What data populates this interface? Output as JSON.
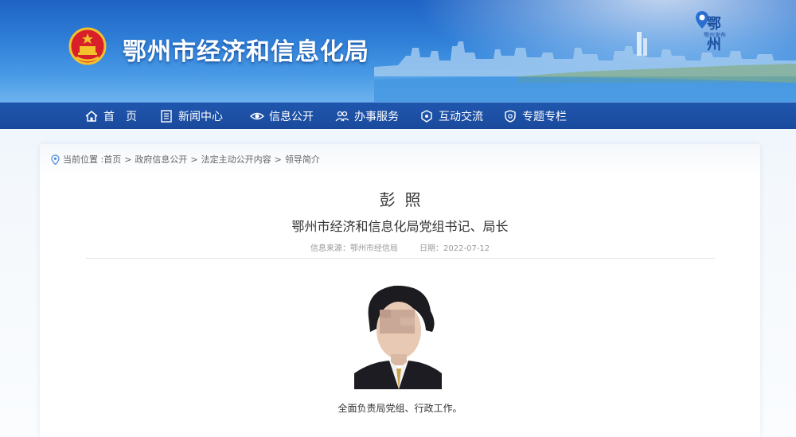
{
  "header": {
    "site_title": "鄂州市经济和信息化局",
    "emblem_icon": "national-emblem-icon",
    "corner_logo_text": "鄂州",
    "corner_logo_sub": "鄂州发布",
    "colors": {
      "banner_top": "#1f63c4",
      "nav_bg": "#1a4a9c"
    }
  },
  "nav": {
    "items": [
      {
        "label": "首　页",
        "icon": "home-icon"
      },
      {
        "label": "新闻中心",
        "icon": "news-icon"
      },
      {
        "label": "信息公开",
        "icon": "eye-icon"
      },
      {
        "label": "办事服务",
        "icon": "service-icon"
      },
      {
        "label": "互动交流",
        "icon": "chat-icon"
      },
      {
        "label": "专题专栏",
        "icon": "shield-icon"
      }
    ]
  },
  "breadcrumb": {
    "prefix": "当前位置 :",
    "items": [
      "首页",
      "政府信息公开",
      "法定主动公开内容",
      "领导简介"
    ]
  },
  "article": {
    "name": "彭照",
    "title": "鄂州市经济和信息化局党组书记、局长",
    "source_label": "信息来源：鄂州市经信局",
    "date_label": "日期：2022-07-12",
    "duty": "全面负责局党组、行政工作。"
  }
}
